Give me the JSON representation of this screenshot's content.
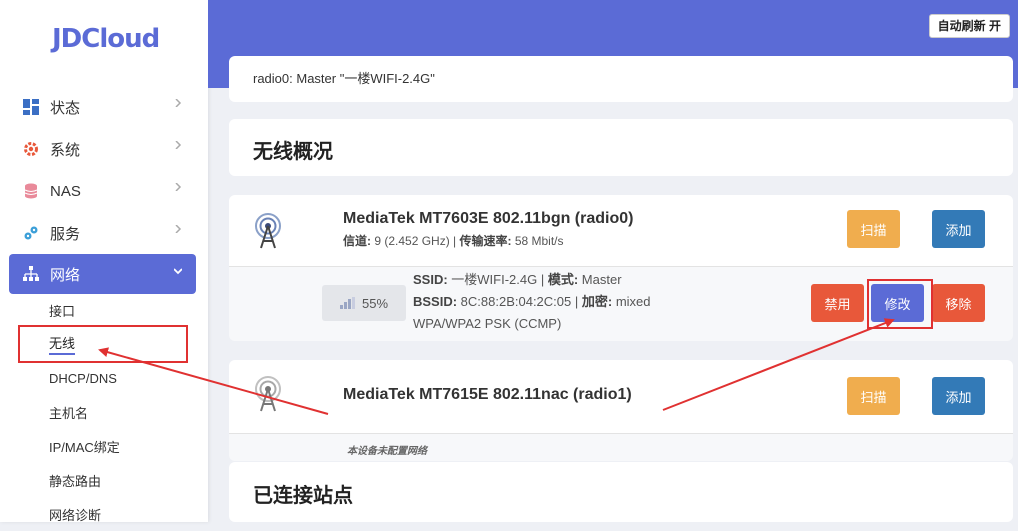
{
  "brand": {
    "logo_text": "JDCloud"
  },
  "header": {
    "auto_refresh_label": "自动刷新 开"
  },
  "sidebar": {
    "items": [
      {
        "label": "状态",
        "icon": "dashboard-icon"
      },
      {
        "label": "系统",
        "icon": "gear-icon"
      },
      {
        "label": "NAS",
        "icon": "database-icon"
      },
      {
        "label": "服务",
        "icon": "puzzle-icon"
      },
      {
        "label": "网络",
        "icon": "network-icon",
        "active": true
      }
    ],
    "subitems": [
      "接口",
      "无线",
      "DHCP/DNS",
      "主机名",
      "IP/MAC绑定",
      "静态路由",
      "网络诊断"
    ],
    "current_subitem": "无线"
  },
  "radio_title": "radio0: Master \"一楼WIFI-2.4G\"",
  "overview_title": "无线概况",
  "devices": [
    {
      "name": "MediaTek MT7603E 802.11bgn (radio0)",
      "channel_label": "信道:",
      "channel_value": " 9 (2.452 GHz) | ",
      "rate_label": "传输速率:",
      "rate_value": " 58 Mbit/s",
      "scan_label": "扫描",
      "add_label": "添加",
      "network": {
        "signal": "55%",
        "ssid_label": "SSID:",
        "ssid_value": " 一楼WIFI-2.4G | ",
        "mode_label": "模式:",
        "mode_value": " Master",
        "bssid_label": "BSSID:",
        "bssid_value": " 8C:88:2B:04:2C:05 | ",
        "enc_label": "加密:",
        "enc_value": " mixed",
        "enc_detail": "WPA/WPA2 PSK (CCMP)",
        "disable_label": "禁用",
        "edit_label": "修改",
        "remove_label": "移除"
      }
    },
    {
      "name": "MediaTek MT7615E 802.11nac (radio1)",
      "scan_label": "扫描",
      "add_label": "添加",
      "note": "本设备未配置网络"
    }
  ],
  "stations_title": "已连接站点",
  "colors": {
    "accent": "#5b6bd6",
    "scan": "#f0ad4e",
    "add": "#337ab7",
    "danger": "#e8583a",
    "annotation": "#e03131"
  }
}
